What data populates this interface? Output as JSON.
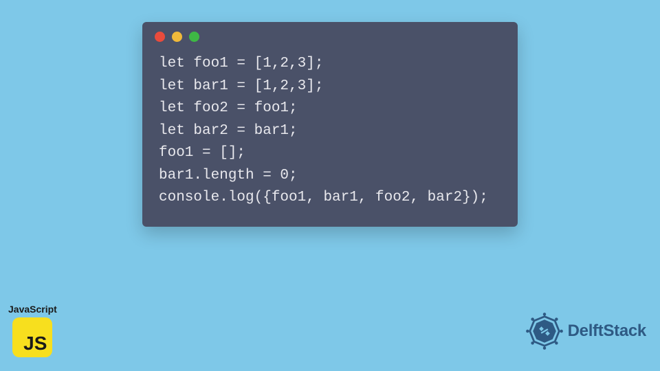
{
  "code": {
    "line1": "let foo1 = [1,2,3];",
    "line2": "let bar1 = [1,2,3];",
    "line3": "let foo2 = foo1;",
    "line4": "let bar2 = bar1;",
    "line5": "foo1 = [];",
    "line6": "bar1.length = 0;",
    "line7": "console.log({foo1, bar1, foo2, bar2});"
  },
  "badges": {
    "js_label": "JavaScript",
    "js_logo_text": "JS",
    "delft_text": "DelftStack"
  },
  "colors": {
    "background": "#7ec8e8",
    "window_bg": "#4a5168",
    "code_text": "#e8e8ed",
    "js_yellow": "#f7df1e",
    "delft_blue": "#2e5a84"
  }
}
